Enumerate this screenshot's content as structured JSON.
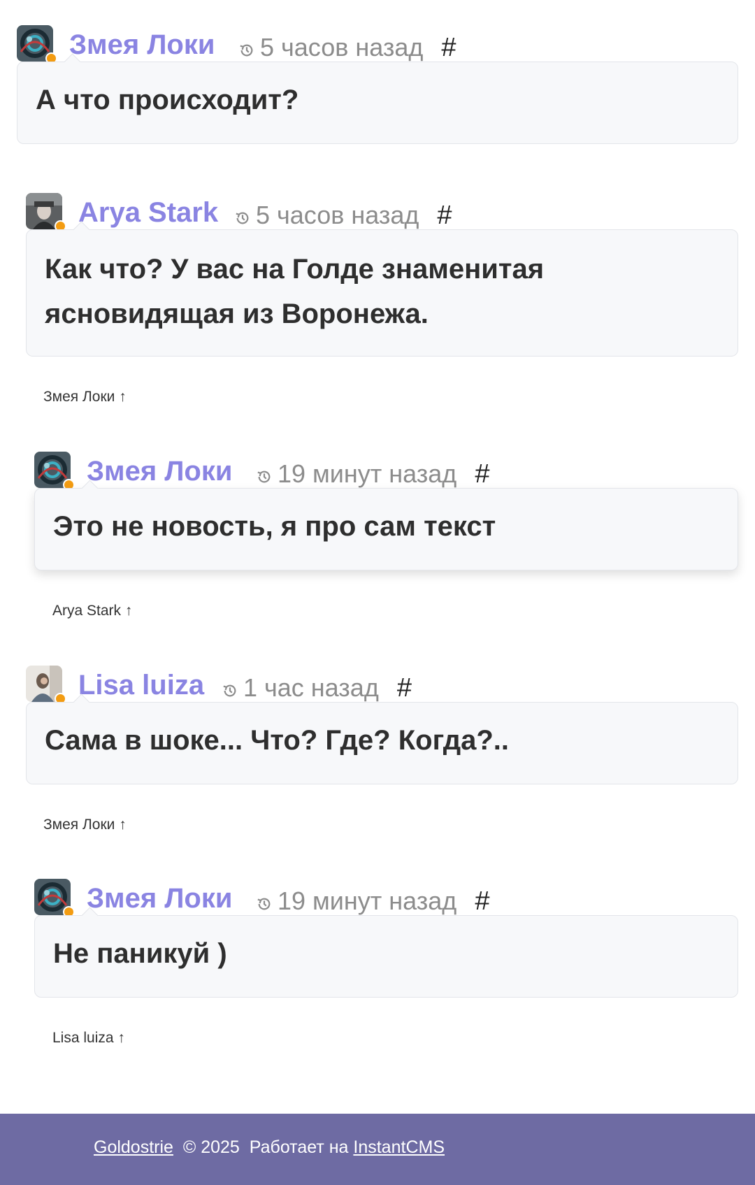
{
  "comments": [
    {
      "author": "Змея Локи",
      "time": "5 часов назад",
      "anchor": "#",
      "text": "А что происходит?",
      "avatar": "snake-avatar"
    },
    {
      "author": "Arya Stark",
      "time": "5 часов назад",
      "anchor": "#",
      "text": "Как что? У вас на Голде знаменитая ясновидящая из Воронежа.",
      "avatar": "arya-avatar",
      "parent_link": "Змея Локи ↑"
    },
    {
      "author": "Змея Локи",
      "time": "19 минут назад",
      "anchor": "#",
      "text": "Это не новость, я про сам текст",
      "avatar": "snake-avatar",
      "parent_link": "Arya Stark ↑"
    },
    {
      "author": "Lisa luiza",
      "time": "1 час назад",
      "anchor": "#",
      "text": "Сама в шоке... Что? Где? Когда?..",
      "avatar": "lisa-avatar",
      "parent_link": "Змея Локи ↑"
    },
    {
      "author": "Змея Локи",
      "time": "19 минут назад",
      "anchor": "#",
      "text": "Не паникуй )",
      "avatar": "snake-avatar",
      "parent_link": "Lisa luiza ↑"
    }
  ],
  "footer": {
    "site_link": "Goldostrie",
    "copyright": "© 2025",
    "powered_by": "Работает на",
    "cms_link": "InstantCMS"
  },
  "colors": {
    "author": "#8a84e2",
    "time": "#8c8c8c",
    "online_dot": "#f39c12",
    "bubble_bg": "#f7f8fa",
    "footer_bg": "#6e6ba3"
  },
  "icons": {
    "time": "history-clock-icon",
    "online": "online-status-dot"
  }
}
